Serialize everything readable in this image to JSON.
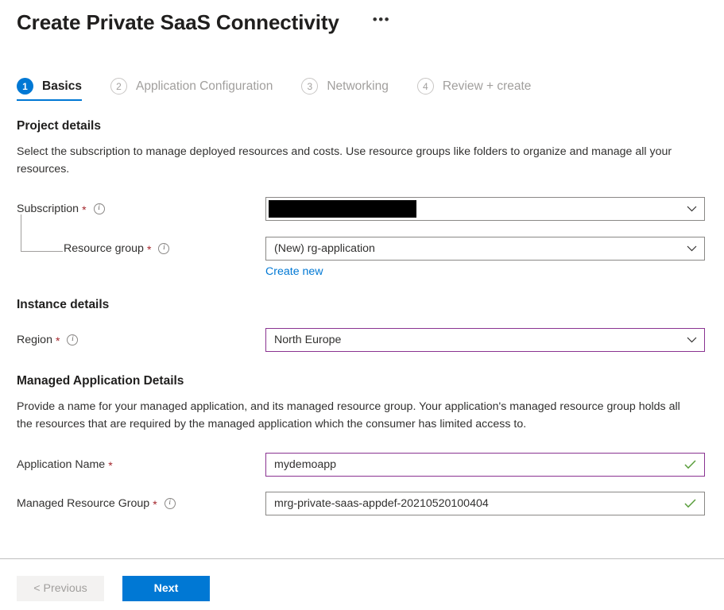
{
  "header": {
    "title": "Create Private SaaS Connectivity",
    "more_label": "•••"
  },
  "tabs": [
    {
      "number": "1",
      "label": "Basics",
      "state": "active"
    },
    {
      "number": "2",
      "label": "Application Configuration",
      "state": "inactive"
    },
    {
      "number": "3",
      "label": "Networking",
      "state": "inactive"
    },
    {
      "number": "4",
      "label": "Review + create",
      "state": "inactive"
    }
  ],
  "project_details": {
    "heading": "Project details",
    "description": "Select the subscription to manage deployed resources and costs. Use resource groups like folders to organize and manage all your resources.",
    "subscription": {
      "label": "Subscription",
      "value": "",
      "redacted": true
    },
    "resource_group": {
      "label": "Resource group",
      "value": "(New) rg-application",
      "create_new_label": "Create new"
    }
  },
  "instance_details": {
    "heading": "Instance details",
    "region": {
      "label": "Region",
      "value": "North Europe"
    }
  },
  "managed_application_details": {
    "heading": "Managed Application Details",
    "description": "Provide a name for your managed application, and its managed resource group. Your application's managed resource group holds all the resources that are required by the managed application which the consumer has limited access to.",
    "application_name": {
      "label": "Application Name",
      "value": "mydemoapp"
    },
    "managed_resource_group": {
      "label": "Managed Resource Group",
      "value": "mrg-private-saas-appdef-20210520100404"
    }
  },
  "footer": {
    "previous_label": "< Previous",
    "next_label": "Next"
  },
  "colors": {
    "accent": "#0078d4",
    "required": "#a4262c",
    "valid": "#5a9e3d",
    "focus_border": "#8a3391",
    "redaction": "#000000"
  }
}
